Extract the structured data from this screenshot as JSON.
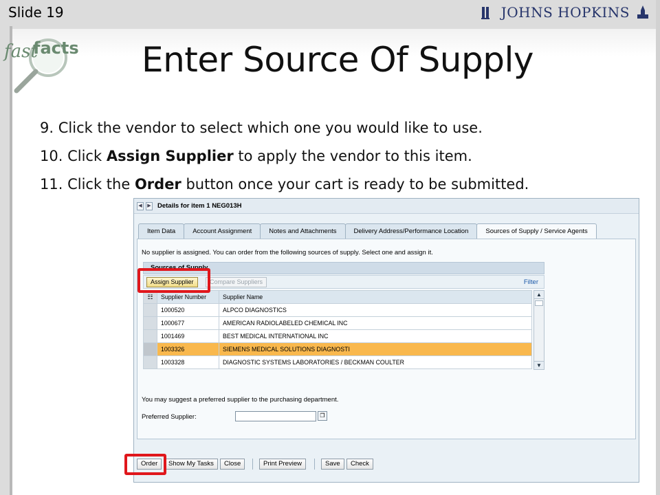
{
  "slide": {
    "number_label": "Slide 19",
    "title": "Enter Source Of Supply",
    "logo_text": "JOHNS HOPKINS",
    "fastfacts": {
      "part1": "fast",
      "part2": "facts"
    },
    "steps": [
      {
        "num": "9.",
        "pre": "Click the vendor to select which one you would like to use.",
        "bold": "",
        "post": ""
      },
      {
        "num": "10.",
        "pre": "Click ",
        "bold": "Assign Supplier",
        "post": " to apply the vendor to this item."
      },
      {
        "num": "11.",
        "pre": "Click the ",
        "bold": "Order",
        "post": " button once your cart is ready to be submitted."
      }
    ]
  },
  "sap": {
    "header_title": "Details for item 1 NEG013H",
    "nav_prev": "◀",
    "nav_next": "▶",
    "tabs": [
      "Item Data",
      "Account Assignment",
      "Notes and Attachments",
      "Delivery Address/Performance Location",
      "Sources of Supply / Service Agents"
    ],
    "active_tab_index": 4,
    "notice": "No supplier is assigned. You can order from the following sources of supply. Select one and assign it.",
    "panel_title": "Sources of Supply",
    "assign_button": "Assign Supplier",
    "compare_button": "Compare Suppliers",
    "filter_link": "Filter",
    "table": {
      "columns": [
        "Supplier Number",
        "Supplier Name"
      ],
      "rows": [
        {
          "number": "1000520",
          "name": "ALPCO DIAGNOSTICS"
        },
        {
          "number": "1000677",
          "name": "AMERICAN RADIOLABELED CHEMICAL INC"
        },
        {
          "number": "1001469",
          "name": "BEST MEDICAL INTERNATIONAL INC"
        },
        {
          "number": "1003326",
          "name": "SIEMENS MEDICAL SOLUTIONS DIAGNOSTI"
        },
        {
          "number": "1003328",
          "name": "DIAGNOSTIC SYSTEMS LABORATORIES / BECKMAN COULTER"
        }
      ],
      "selected_row_index": 3
    },
    "suggest_text": "You may suggest a preferred supplier to the purchasing department.",
    "preferred_label": "Preferred Supplier:",
    "preferred_value": "",
    "bottom_buttons": {
      "order": "Order",
      "show_tasks": "Show My Tasks",
      "close": "Close",
      "print_preview": "Print Preview",
      "save": "Save",
      "check": "Check"
    }
  },
  "colors": {
    "highlight_box": "#e0171c",
    "selected_row": "#f9b84d",
    "logo_blue": "#27356b"
  }
}
